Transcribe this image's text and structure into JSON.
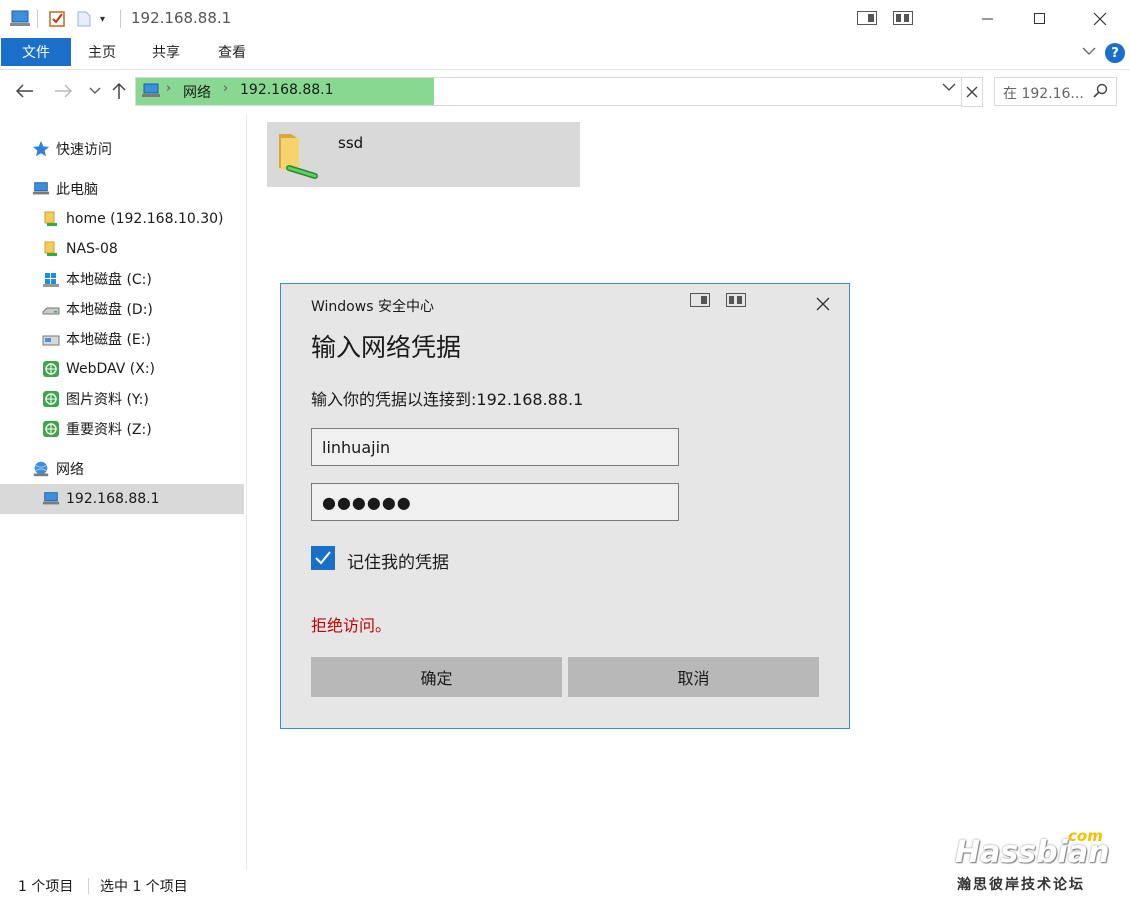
{
  "titlebar": {
    "title": "192.168.88.1"
  },
  "ribbon": {
    "file_tab": "文件",
    "tabs": [
      "主页",
      "共享",
      "查看"
    ],
    "help": "?"
  },
  "address": {
    "crumbs": [
      "网络",
      "192.168.88.1"
    ],
    "search_placeholder": "在 192.16..."
  },
  "sidebar": {
    "items": [
      {
        "label": "快速访问",
        "icon": "star-icon"
      },
      {
        "label": "此电脑",
        "icon": "computer-icon"
      },
      {
        "label": "home (192.168.10.30)",
        "icon": "network-drive-icon"
      },
      {
        "label": "NAS-08",
        "icon": "network-drive-icon"
      },
      {
        "label": "本地磁盘 (C:)",
        "icon": "windows-drive-icon"
      },
      {
        "label": "本地磁盘 (D:)",
        "icon": "drive-icon"
      },
      {
        "label": "本地磁盘 (E:)",
        "icon": "drive-icon"
      },
      {
        "label": "WebDAV (X:)",
        "icon": "web-drive-icon"
      },
      {
        "label": "图片资料 (Y:)",
        "icon": "web-drive-icon"
      },
      {
        "label": "重要资料 (Z:)",
        "icon": "web-drive-icon"
      },
      {
        "label": "网络",
        "icon": "network-icon"
      },
      {
        "label": "192.168.88.1",
        "icon": "computer-icon"
      }
    ]
  },
  "content": {
    "folder_name": "ssd"
  },
  "dialog": {
    "caption": "Windows 安全中心",
    "heading": "输入网络凭据",
    "prompt": "输入你的凭据以连接到:192.168.88.1",
    "username": "linhuajin",
    "password_mask": "●●●●●●",
    "remember_label": "记住我的凭据",
    "remember_checked": true,
    "error": "拒绝访问。",
    "ok_label": "确定",
    "cancel_label": "取消"
  },
  "statusbar": {
    "count": "1 个项目",
    "selected": "选中 1 个项目"
  },
  "watermark": {
    "main": "Hassbian",
    "com": "com",
    "sub": "瀚思彼岸技术论坛"
  },
  "colors": {
    "accent": "#1a6fc9",
    "address_fill": "#88d891",
    "error": "#c00000",
    "dialog_border": "#3d8ccf"
  }
}
